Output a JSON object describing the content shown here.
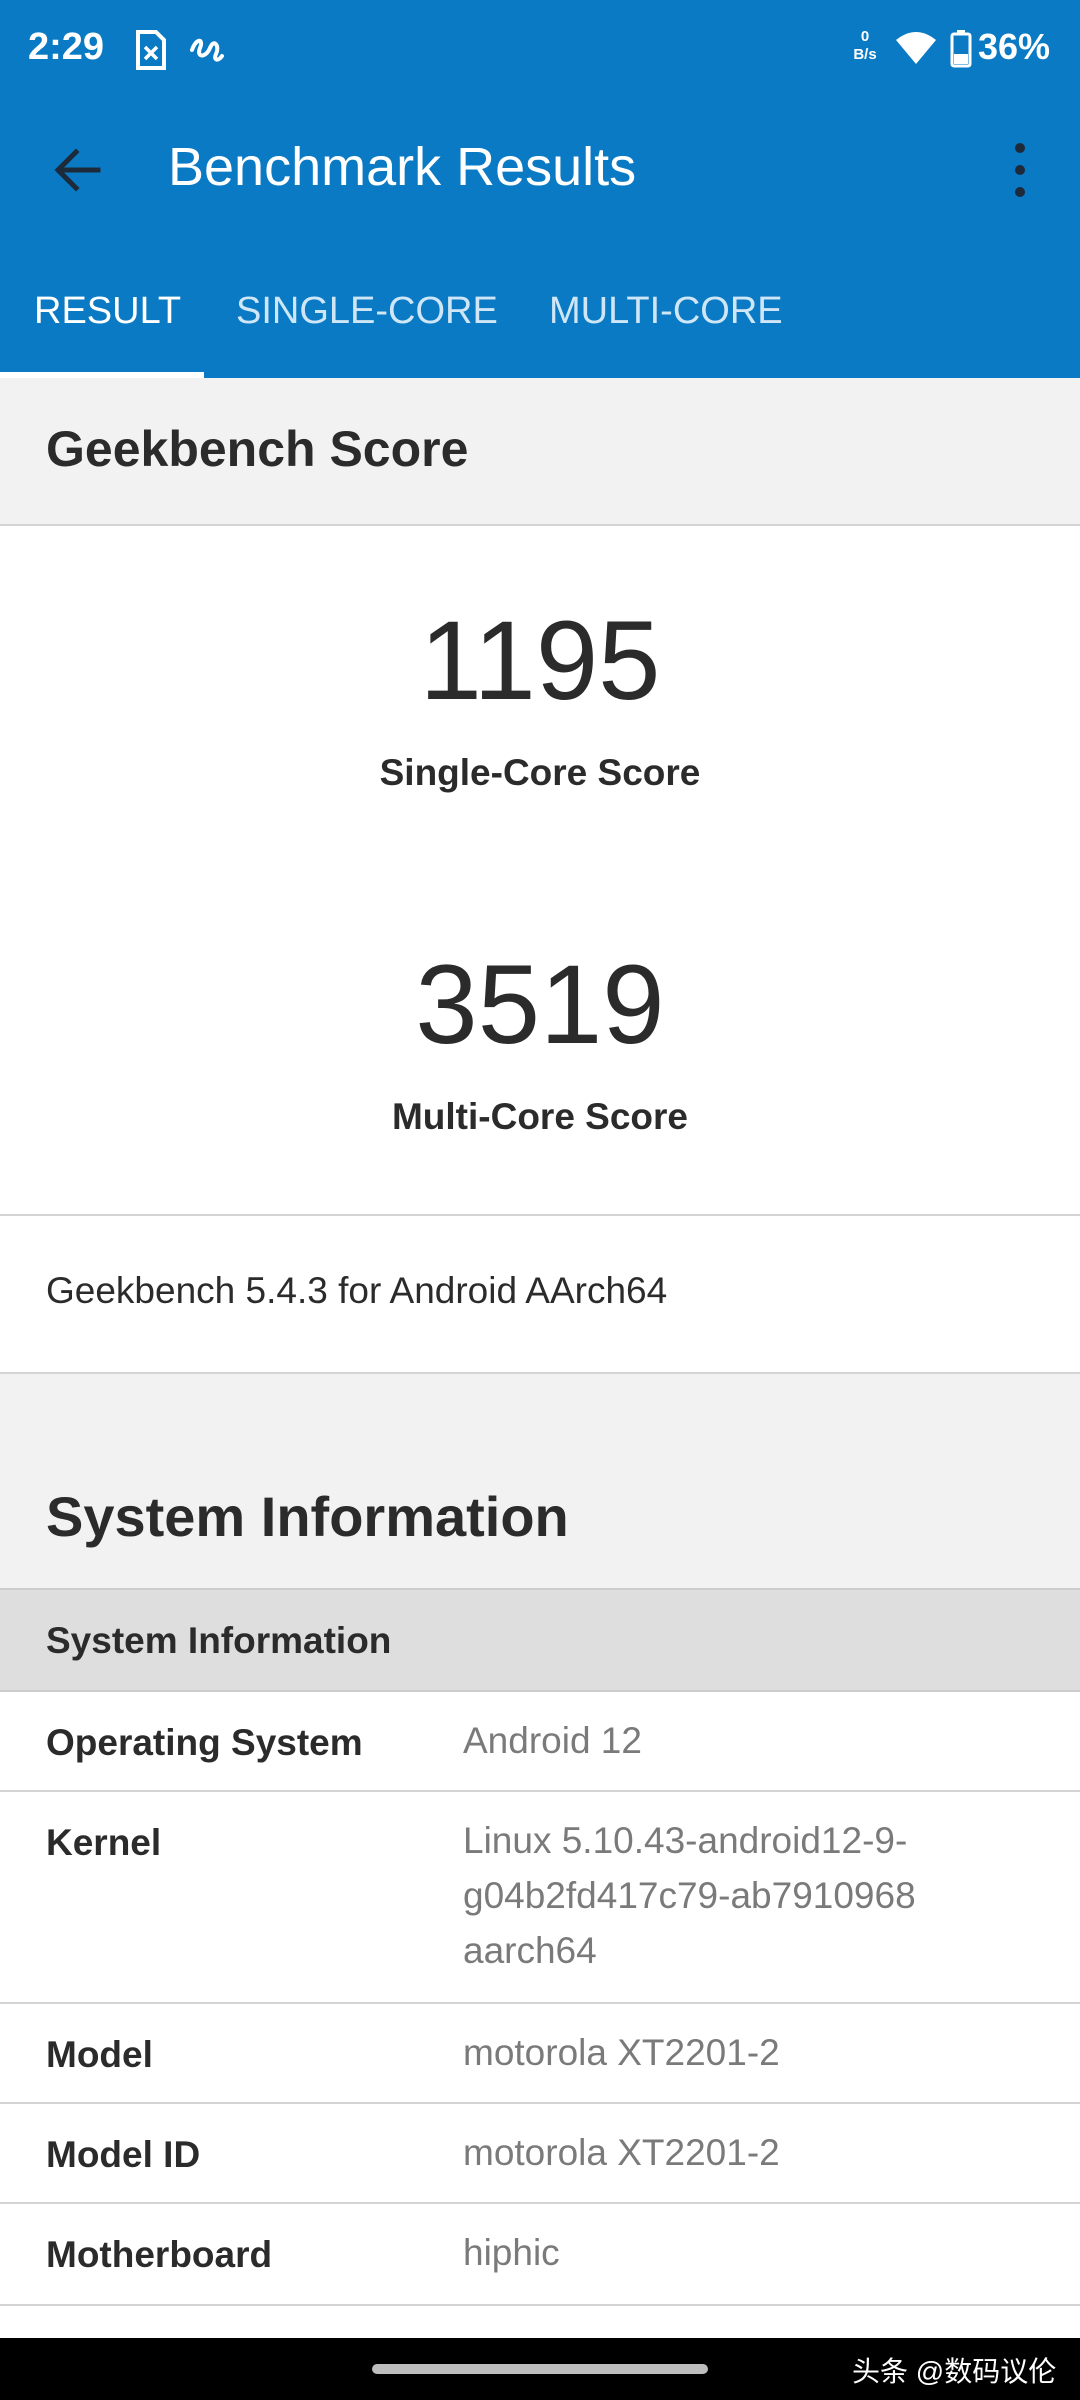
{
  "status_bar": {
    "time": "2:29",
    "net_speed_value": "0",
    "net_speed_unit": "B/s",
    "battery": "36%",
    "icons": [
      "sim-card-icon",
      "notification-icon",
      "wifi-icon",
      "battery-icon"
    ]
  },
  "app_bar": {
    "title": "Benchmark Results",
    "back_icon": "arrow-back-icon",
    "menu_icon": "more-vert-icon",
    "color": "#0a7ac4"
  },
  "tabs": [
    {
      "label": "RESULT",
      "active": true
    },
    {
      "label": "SINGLE-CORE",
      "active": false
    },
    {
      "label": "MULTI-CORE",
      "active": false
    }
  ],
  "geekbench": {
    "section_title": "Geekbench Score",
    "single_core": {
      "value": "1195",
      "label": "Single-Core Score"
    },
    "multi_core": {
      "value": "3519",
      "label": "Multi-Core Score"
    },
    "version": "Geekbench 5.4.3 for Android AArch64"
  },
  "system": {
    "section_title": "System Information",
    "group_title": "System Information",
    "rows": [
      {
        "key": "Operating System",
        "value_lines": [
          "Android 12"
        ]
      },
      {
        "key": "Kernel",
        "value_lines": [
          "Linux 5.10.43-android12-9-",
          "g04b2fd417c79-ab7910968",
          "aarch64"
        ]
      },
      {
        "key": "Model",
        "value_lines": [
          "motorola XT2201-2"
        ]
      },
      {
        "key": "Model ID",
        "value_lines": [
          "motorola XT2201-2"
        ]
      },
      {
        "key": "Motherboard",
        "value_lines": [
          "hiphic"
        ]
      }
    ]
  },
  "watermark": "头条 @数码议伦"
}
